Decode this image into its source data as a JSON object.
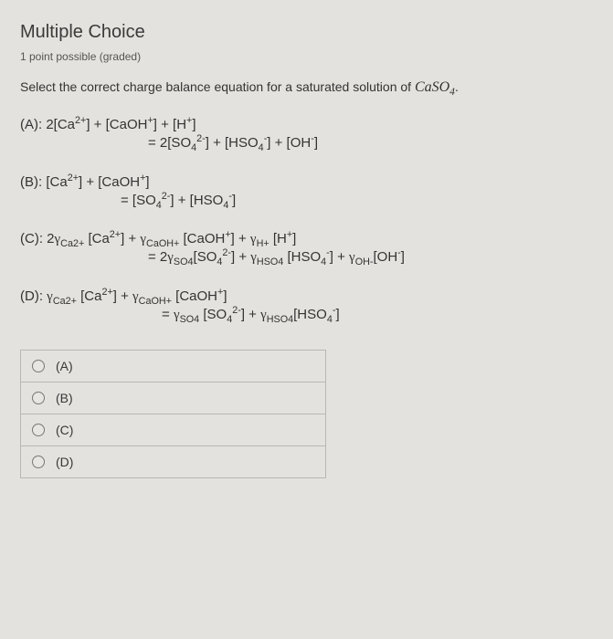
{
  "heading": "Multiple Choice",
  "grading": "1 point possible (graded)",
  "prompt_pre": "Select the correct charge balance equation for a saturated solution of ",
  "compound_html": "CaSO",
  "compound_sub": "4",
  "prompt_post": ".",
  "options": {
    "A": {
      "label": "(A): ",
      "line1": "2[Ca<sup>2+</sup>] + [CaOH<sup>+</sup>] + [H<sup>+</sup>]",
      "line2": "= 2[SO<sub>4</sub><sup>2-</sup>] + [HSO<sub>4</sub><sup>-</sup>] + [OH<sup>-</sup>]"
    },
    "B": {
      "label": "(B): ",
      "line1": "[Ca<sup>2+</sup>] + [CaOH<sup>+</sup>]",
      "line2": "= [SO<sub>4</sub><sup>2-</sup>] + [HSO<sub>4</sub><sup>-</sup>]"
    },
    "C": {
      "label": "(C): ",
      "line1": "2<span class='gamma'>γ</span><sub>Ca2+</sub> [Ca<sup>2+</sup>] + <span class='gamma'>γ</span><sub>CaOH+</sub> [CaOH<sup>+</sup>] + <span class='gamma'>γ</span><sub>H+</sub> [H<sup>+</sup>]",
      "line2": "= 2<span class='gamma'>γ</span><sub>SO4</sub>[SO<sub>4</sub><sup>2-</sup>] + <span class='gamma'>γ</span><sub>HSO4</sub> [HSO<sub>4</sub><sup>-</sup>] + <span class='gamma'>γ</span><sub>OH-</sub>[OH<sup>-</sup>]"
    },
    "D": {
      "label": "(D): ",
      "line1": "<span class='gamma'>γ</span><sub>Ca2+</sub> [Ca<sup>2+</sup>] + <span class='gamma'>γ</span><sub>CaOH+</sub> [CaOH<sup>+</sup>]",
      "line2": "= <span class='gamma'>γ</span><sub>SO4</sub> [SO<sub>4</sub><sup>2-</sup>] + <span class='gamma'>γ</span><sub>HSO4</sub>[HSO<sub>4</sub><sup>-</sup>]"
    }
  },
  "choices": [
    "(A)",
    "(B)",
    "(C)",
    "(D)"
  ]
}
